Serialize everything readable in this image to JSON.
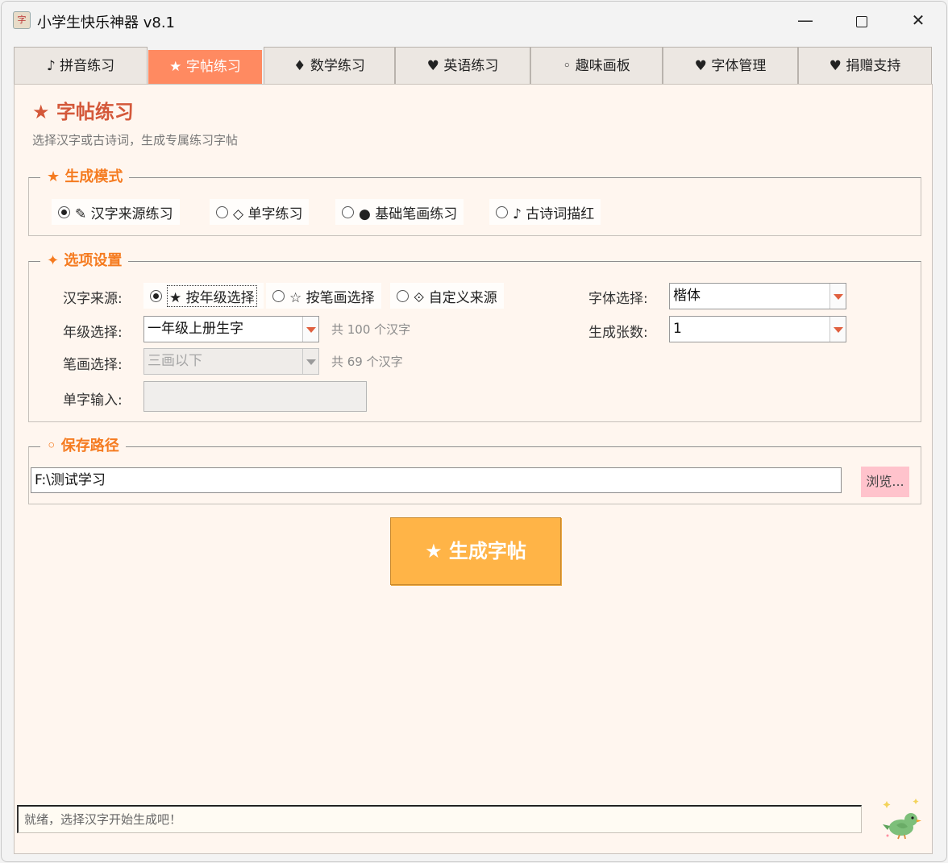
{
  "window": {
    "title": "小学生快乐神器 v8.1",
    "minimize": "—",
    "close": "✕"
  },
  "tabs": [
    {
      "label": "♪ 拼音练习"
    },
    {
      "label": "★ 字帖练习",
      "active": true
    },
    {
      "label": "♦ 数学练习"
    },
    {
      "label": "♥ 英语练习"
    },
    {
      "label": "◦ 趣味画板"
    },
    {
      "label": "♥ 字体管理"
    },
    {
      "label": "♥ 捐赠支持"
    }
  ],
  "page": {
    "title": "★ 字帖练习",
    "subtitle": "选择汉字或古诗词，生成专属练习字帖"
  },
  "mode_group": {
    "title": "★ 生成模式",
    "options": [
      {
        "label": "✎ 汉字来源练习",
        "selected": true
      },
      {
        "label": "◇ 单字练习",
        "selected": false
      },
      {
        "label": "● 基础笔画练习",
        "selected": false
      },
      {
        "label": "♪ 古诗词描红",
        "selected": false
      }
    ]
  },
  "options_group": {
    "title": "✦ 选项设置",
    "source_label": "汉字来源:",
    "source_options": [
      {
        "label": "★ 按年级选择",
        "selected": true
      },
      {
        "label": "☆ 按笔画选择",
        "selected": false
      },
      {
        "label": "⟐ 自定义来源",
        "selected": false
      }
    ],
    "grade_label": "年级选择:",
    "grade_value": "一年级上册生字",
    "grade_hint": "共 100 个汉字",
    "stroke_label": "笔画选择:",
    "stroke_value": "三画以下",
    "stroke_hint": "共 69 个汉字",
    "single_label": "单字输入:",
    "single_value": "",
    "font_label": "字体选择:",
    "font_value": "楷体",
    "sheets_label": "生成张数:",
    "sheets_value": "1"
  },
  "save_group": {
    "title": "◦ 保存路径",
    "path": "F:\\测试学习",
    "browse_label": "浏览..."
  },
  "generate_button": "★ 生成字帖",
  "status": "就绪，选择汉字开始生成吧！",
  "colors": {
    "accent_tab": "#ff8a61",
    "title_color": "#d4583a",
    "group_title": "#f57b20",
    "generate": "#ffb447",
    "browse": "#ffc3cc",
    "panel_bg": "#fff6ef"
  },
  "icons": {
    "app": "app-icon",
    "mascot": "bird-icon"
  }
}
